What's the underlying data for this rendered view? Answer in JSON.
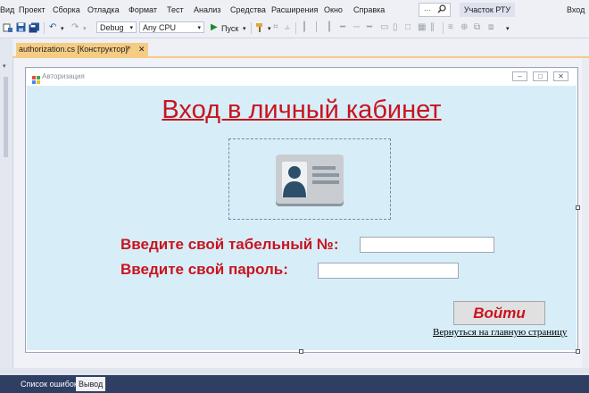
{
  "menu": {
    "items": [
      "Вид",
      "Проект",
      "Сборка",
      "Отладка",
      "Формат",
      "Тест",
      "Анализ",
      "Средства",
      "Расширения",
      "Окно",
      "Справка"
    ],
    "search_dots": "...",
    "account": "Участок РТУ",
    "login": "Вход"
  },
  "toolbar": {
    "config": "Debug",
    "platform": "Any CPU",
    "run_label": "Пуск"
  },
  "document": {
    "tab_label": "authorization.cs [Конструктор]*"
  },
  "form": {
    "window_title": "Авторизация",
    "heading": "Вход в личный кабинет",
    "employee_label": "Введите свой табельный №:",
    "employee_value": "",
    "password_label": "Введите свой пароль:",
    "password_value": "",
    "submit_label": "Войти",
    "back_link": "Вернуться на главную страницу"
  },
  "bottom_tabs": [
    "Список ошибок",
    "Вывод"
  ],
  "colors": {
    "accent_red": "#c8141e",
    "form_bg": "#d7eef9",
    "tab_active": "#f5cc84",
    "status_bar": "#2f3e63"
  }
}
